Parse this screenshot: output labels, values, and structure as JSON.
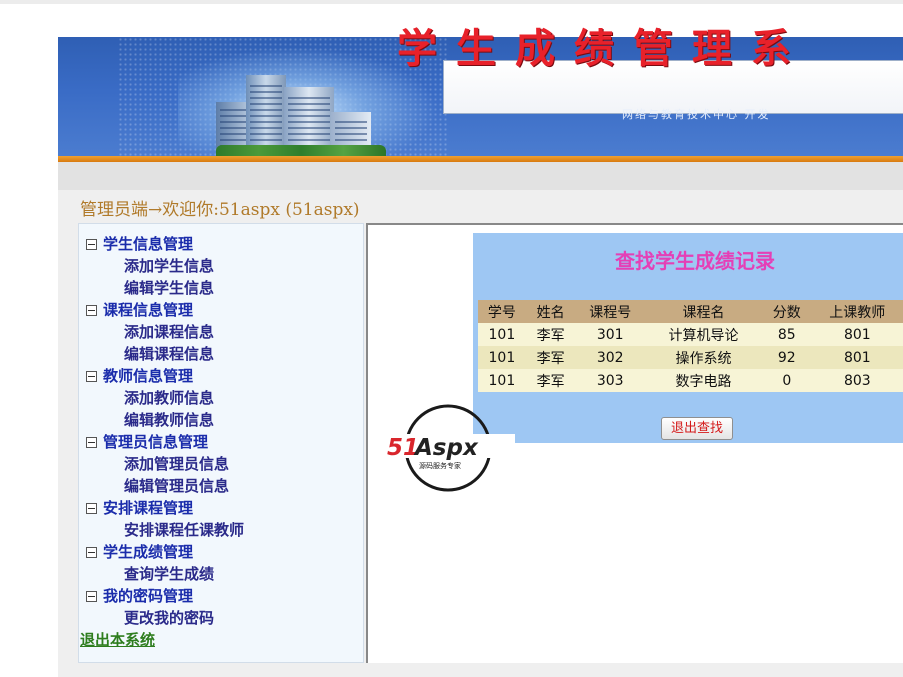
{
  "banner": {
    "title": "学生成绩管理系",
    "subtitle": "网络与教育技术中心 开发"
  },
  "welcome": "管理员端→欢迎你:51aspx (51aspx)",
  "sidebar": {
    "groups": [
      {
        "label": "学生信息管理",
        "items": [
          "添加学生信息",
          "编辑学生信息"
        ]
      },
      {
        "label": "课程信息管理",
        "items": [
          "添加课程信息",
          "编辑课程信息"
        ]
      },
      {
        "label": "教师信息管理",
        "items": [
          "添加教师信息",
          "编辑教师信息"
        ]
      },
      {
        "label": "管理员信息管理",
        "items": [
          "添加管理员信息",
          "编辑管理员信息"
        ]
      },
      {
        "label": "安排课程管理",
        "items": [
          "安排课程任课教师"
        ]
      },
      {
        "label": "学生成绩管理",
        "items": [
          "查询学生成绩"
        ]
      },
      {
        "label": "我的密码管理",
        "items": [
          "更改我的密码"
        ]
      }
    ],
    "exit": "退出本系统"
  },
  "main": {
    "title": "查找学生成绩记录",
    "columns": [
      "学号",
      "姓名",
      "课程号",
      "课程名",
      "分数",
      "上课教师"
    ],
    "rows": [
      [
        "101",
        "李军",
        "301",
        "计算机导论",
        "85",
        "801"
      ],
      [
        "101",
        "李军",
        "302",
        "操作系统",
        "92",
        "801"
      ],
      [
        "101",
        "李军",
        "303",
        "数字电路",
        "0",
        "803"
      ]
    ],
    "exit_button": "退出查找"
  },
  "watermark": {
    "brand": "51Aspx",
    "tagline": "源码服务专家"
  },
  "colors": {
    "banner_blue": "#3a6cc6",
    "title_red": "#e8212a",
    "card_blue": "#9ec7f3",
    "table_header": "#c8ab82",
    "card_title": "#e53fb6"
  }
}
